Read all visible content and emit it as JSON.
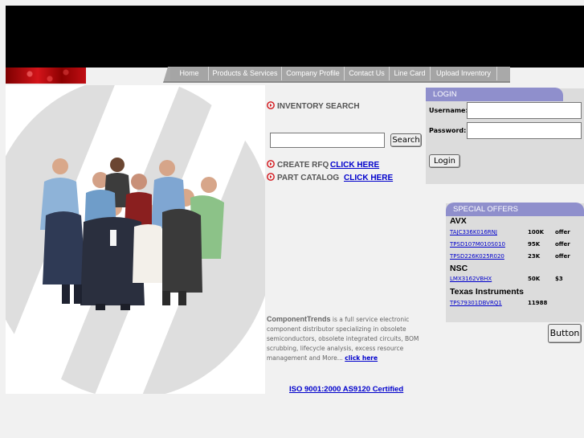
{
  "nav": {
    "home": "Home",
    "products": "Products & Services",
    "profile": "Company Profile",
    "contact": "Contact Us",
    "linecard": "Line Card",
    "upload": "Upload Inventory"
  },
  "inventory": {
    "title": "INVENTORY SEARCH",
    "search_value": "",
    "search_button": "Search",
    "rfq_label": "CREATE RFQ",
    "rfq_link": "CLICK HERE",
    "catalog_label": "PART CATALOG",
    "catalog_link": "CLICK HERE"
  },
  "about": {
    "company": "ComponentTrends",
    "text": " is a full service electronic component distributor specializing in obsolete semiconductors, obsolete integrated circuits, BOM scrubbing, lifecycle analysis, excess resource management and More... ",
    "link": "click here"
  },
  "iso": "ISO 9001:2000 AS9120 Certified",
  "login": {
    "title": "LOGIN",
    "username_label": "Username:",
    "password_label": "Password:",
    "button": "Login"
  },
  "offers": {
    "title": "SPECIAL OFFERS",
    "vendors": [
      {
        "name": "AVX",
        "items": [
          {
            "part": "TAJC336K016RNJ",
            "qty": "100K",
            "action": "offer"
          },
          {
            "part": "TPSD107M010S010",
            "qty": "95K",
            "action": "offer"
          },
          {
            "part": "TPSD226K025R020",
            "qty": "23K",
            "action": "offer"
          }
        ]
      },
      {
        "name": "NSC",
        "items": [
          {
            "part": "LMX3162VBHX",
            "qty": "50K",
            "action": "$3"
          }
        ]
      },
      {
        "name": "Texas Instruments",
        "items": [
          {
            "part": "TPS79301DBVRQ1",
            "qty": "11988",
            "action": ""
          }
        ]
      }
    ]
  },
  "extra_button": "Button",
  "colors": {
    "panel_header": "#8f8fcc",
    "link": "#0000cc",
    "accent_red": "#d4141a"
  }
}
